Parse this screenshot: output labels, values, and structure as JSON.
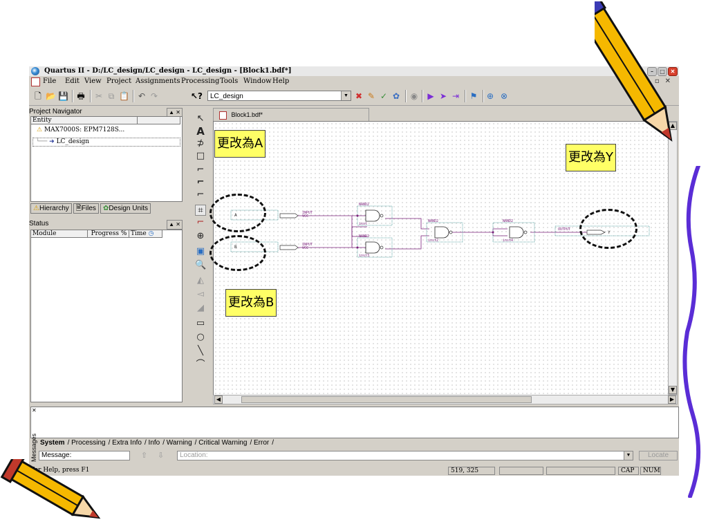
{
  "window": {
    "title": "Quartus II - D:/LC_design/LC_design - LC_design - [Block1.bdf*]"
  },
  "menu": [
    "File",
    "Edit",
    "View",
    "Project",
    "Assignments",
    "Processing",
    "Tools",
    "Window",
    "Help"
  ],
  "toolbar": {
    "project_value": "LC_design"
  },
  "navigator": {
    "title": "Project Navigator",
    "column": "Entity",
    "device": "MAX7000S: EPM7128S...",
    "entity": "LC_design",
    "tabs": [
      "Hierarchy",
      "Files",
      "Design Units"
    ]
  },
  "status_panel": {
    "title": "Status",
    "columns": [
      "Module",
      "Progress %",
      "Time"
    ]
  },
  "editor": {
    "tab": "Block1.bdf*"
  },
  "schematic": {
    "inputs": [
      {
        "name": "A",
        "type": "INPUT",
        "default": "VCC"
      },
      {
        "name": "B",
        "type": "INPUT",
        "default": "VCC"
      }
    ],
    "gates": [
      {
        "type": "NAND2",
        "inst": "inst"
      },
      {
        "type": "NAND2",
        "inst": "inst3"
      },
      {
        "type": "NAND2",
        "inst": "inst2"
      },
      {
        "type": "NAND2",
        "inst": "inst4"
      }
    ],
    "output": {
      "name": "Y",
      "type": "OUTPUT"
    }
  },
  "callouts": {
    "a": "更改為A",
    "b": "更改為B",
    "y": "更改為Y"
  },
  "messages": {
    "tabs": [
      "System",
      "Processing",
      "Extra Info",
      "Info",
      "Warning",
      "Critical Warning",
      "Error"
    ],
    "side_label": "Messages",
    "message_label": "Message:",
    "location_placeholder": "Location:",
    "locate_label": "Locate"
  },
  "statusbar": {
    "help": "For Help, press F1",
    "coords": "519, 325",
    "caps": "CAP",
    "num": "NUM"
  },
  "colors": {
    "highlight": "#ffff66",
    "wire": "#7a1f7a",
    "pencil_body": "#f5b800",
    "pencil_tip": "#c0392b",
    "squiggle": "#5a2dd6"
  }
}
